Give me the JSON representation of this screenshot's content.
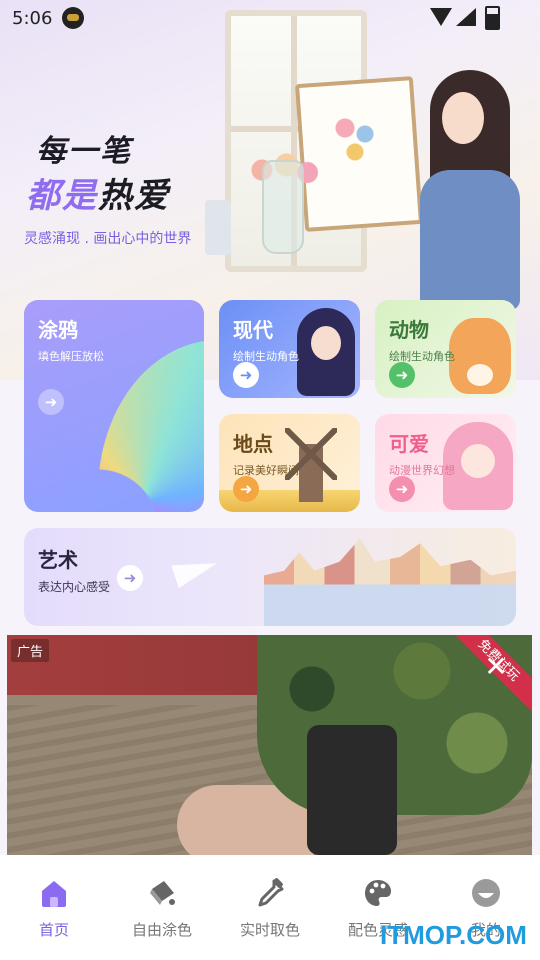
{
  "status_bar": {
    "time": "5:06"
  },
  "hero": {
    "slogan_line1": "每一笔",
    "slogan_line2_accent": "都是",
    "slogan_line2_rest": "热爱",
    "tagline": "灵感涌现 . 画出心中的世界"
  },
  "cards": {
    "doodle": {
      "title": "涂鸦",
      "subtitle": "填色解压放松"
    },
    "modern": {
      "title": "现代",
      "subtitle": "绘制生动角色"
    },
    "animal": {
      "title": "动物",
      "subtitle": "绘制生动角色"
    },
    "place": {
      "title": "地点",
      "subtitle": "记录美好瞬间"
    },
    "cute": {
      "title": "可爱",
      "subtitle": "动漫世界幻想"
    },
    "art": {
      "title": "艺术",
      "subtitle": "表达内心感受"
    }
  },
  "ad": {
    "label": "广告",
    "ribbon": "免费试玩",
    "close": "✕"
  },
  "nav": {
    "items": [
      {
        "label": "首页",
        "icon": "home-icon",
        "active": true
      },
      {
        "label": "自由涂色",
        "icon": "paint-bucket-icon",
        "active": false
      },
      {
        "label": "实时取色",
        "icon": "eyedropper-icon",
        "active": false
      },
      {
        "label": "配色灵感",
        "icon": "palette-icon",
        "active": false
      },
      {
        "label": "我的",
        "icon": "profile-icon",
        "active": false
      }
    ]
  },
  "colors": {
    "accent": "#7b5fe0",
    "ad_ribbon": "#d2304a"
  },
  "watermark": "ITMOP.COM"
}
